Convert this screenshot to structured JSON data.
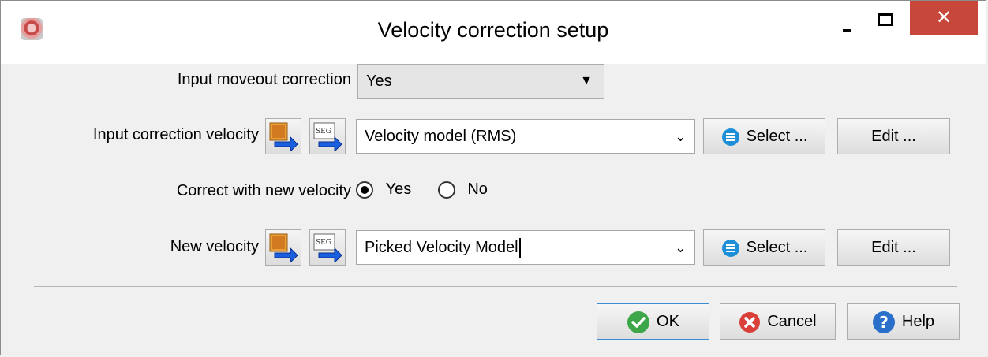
{
  "window": {
    "title": "Velocity correction setup",
    "close_glyph": "✕"
  },
  "form": {
    "moveout": {
      "label": "Input moveout correction",
      "value": "Yes"
    },
    "input_velocity": {
      "label": "Input correction velocity",
      "value": "Velocity model (RMS)",
      "select_label": "Select ...",
      "edit_label": "Edit ..."
    },
    "correct_new": {
      "label": "Correct with new velocity",
      "options": [
        "Yes",
        "No"
      ],
      "selected": "Yes"
    },
    "new_velocity": {
      "label": "New velocity",
      "value": "Picked Velocity Model",
      "select_label": "Select ...",
      "edit_label": "Edit ..."
    }
  },
  "footer": {
    "ok_label": "OK",
    "cancel_label": "Cancel",
    "help_label": "Help"
  },
  "icons": {
    "import_file": "import-file-icon",
    "import_seg": "import-segy-icon",
    "select": "list-icon",
    "ok": "check-icon",
    "cancel": "x-icon",
    "help": "question-icon"
  },
  "colors": {
    "close_button": "#c7473a",
    "ok_green": "#3ca648",
    "cancel_red": "#d9403a",
    "help_blue": "#2a6fc9",
    "select_blue": "#1d8fd9"
  }
}
